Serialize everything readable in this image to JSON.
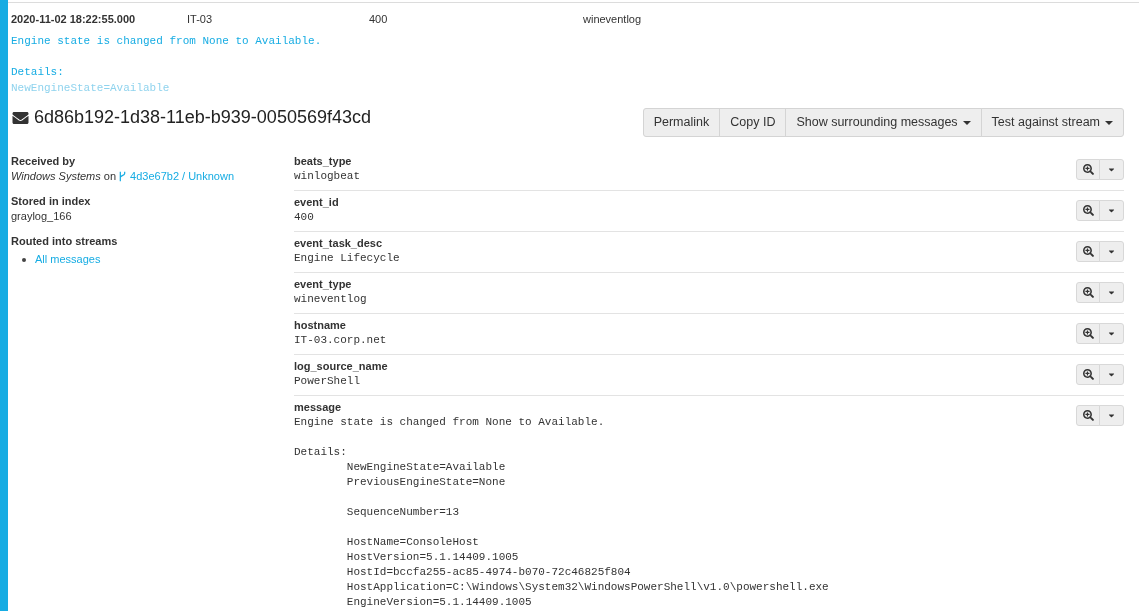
{
  "summary_row": {
    "cells": [
      "2020-11-02 18:22:55.000",
      "IT-03",
      "400",
      "wineventlog"
    ],
    "preview": "Engine state is changed from None to Available.\n\nDetails:\nNewEngineState=Available"
  },
  "message": {
    "id": "6d86b192-1d38-11eb-b939-0050569f43cd",
    "actions": [
      {
        "label": "Permalink",
        "has_menu": false
      },
      {
        "label": "Copy ID",
        "has_menu": false
      },
      {
        "label": "Show surrounding messages",
        "has_menu": true
      },
      {
        "label": "Test against stream",
        "has_menu": true
      }
    ]
  },
  "details": {
    "received_by": {
      "label": "Received by",
      "text": "*Windows Systems* on",
      "node_link": "4d3e67b2 / Unknown"
    },
    "stored_in_index": {
      "label": "Stored in index",
      "value": "graylog_166"
    },
    "routed_into_streams": {
      "label": "Routed into streams",
      "streams": [
        "All messages"
      ]
    }
  },
  "fields": [
    {
      "name": "beats_type",
      "value": "winlogbeat"
    },
    {
      "name": "event_id",
      "value": "400"
    },
    {
      "name": "event_task_desc",
      "value": "Engine Lifecycle"
    },
    {
      "name": "event_type",
      "value": "wineventlog"
    },
    {
      "name": "hostname",
      "value": "IT-03.corp.net"
    },
    {
      "name": "log_source_name",
      "value": "PowerShell"
    },
    {
      "name": "message",
      "value": "Engine state is changed from None to Available.\n\nDetails:\n\tNewEngineState=Available\n\tPreviousEngineState=None\n\n\tSequenceNumber=13\n\n\tHostName=ConsoleHost\n\tHostVersion=5.1.14409.1005\n\tHostId=bccfa255-ac85-4974-b070-72c46825f804\n\tHostApplication=C:\\Windows\\System32\\WindowsPowerShell\\v1.0\\powershell.exe\n\tEngineVersion=5.1.14409.1005"
    }
  ]
}
